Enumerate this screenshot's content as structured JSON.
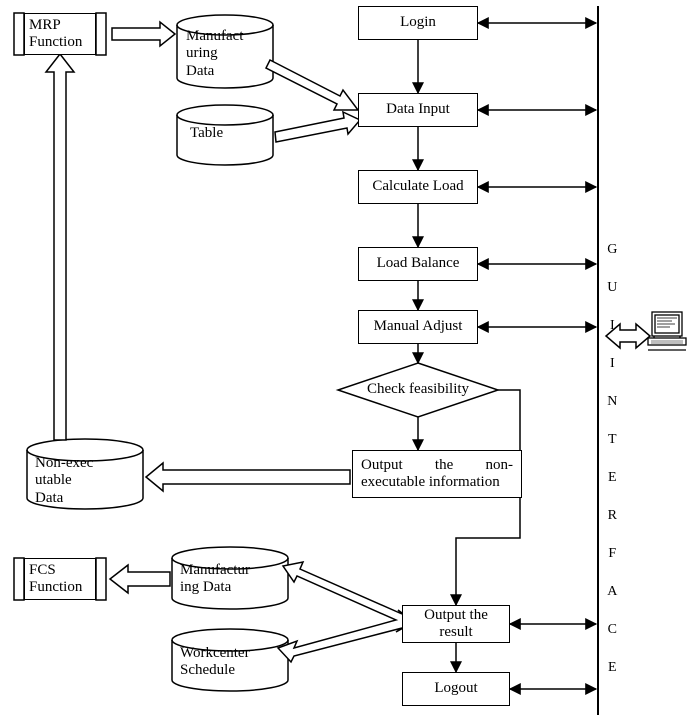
{
  "flow": {
    "login": "Login",
    "data_input": "Data Input",
    "calc_load": "Calculate Load",
    "load_balance": "Load Balance",
    "manual_adjust": "Manual Adjust",
    "check_feasibility": "Check feasibility",
    "output_nonexec": "Output the non-executable information",
    "output_result": "Output the result",
    "logout": "Logout"
  },
  "side": {
    "mrp": "MRP Function",
    "fcs": "FCS Function",
    "gui": "G U I   I N T E R F A C E"
  },
  "cyl": {
    "mfg_data_top": "Manufact\nuring\nData",
    "table": "Table",
    "nonexec": "Non-exec\nutable\nData",
    "mfg_data_bot": "Manufactur\ning Data",
    "workcenter": "Workcenter\nSchedule"
  },
  "chart_data": {
    "type": "diagram",
    "title": "",
    "nodes": [
      {
        "id": "mrp",
        "type": "process",
        "label": "MRP Function"
      },
      {
        "id": "mfg_data_top",
        "type": "datastore",
        "label": "Manufacturing Data"
      },
      {
        "id": "table",
        "type": "datastore",
        "label": "Table"
      },
      {
        "id": "login",
        "type": "process",
        "label": "Login"
      },
      {
        "id": "data_input",
        "type": "process",
        "label": "Data Input"
      },
      {
        "id": "calc_load",
        "type": "process",
        "label": "Calculate Load"
      },
      {
        "id": "load_balance",
        "type": "process",
        "label": "Load Balance"
      },
      {
        "id": "manual_adjust",
        "type": "process",
        "label": "Manual Adjust"
      },
      {
        "id": "check_feasibility",
        "type": "decision",
        "label": "Check feasibility"
      },
      {
        "id": "output_nonexec",
        "type": "process",
        "label": "Output the non-executable information"
      },
      {
        "id": "nonexec_data",
        "type": "datastore",
        "label": "Non-executable Data"
      },
      {
        "id": "fcs",
        "type": "process",
        "label": "FCS Function"
      },
      {
        "id": "mfg_data_bot",
        "type": "datastore",
        "label": "Manufacturing Data"
      },
      {
        "id": "workcenter",
        "type": "datastore",
        "label": "Workcenter Schedule"
      },
      {
        "id": "output_result",
        "type": "process",
        "label": "Output the result"
      },
      {
        "id": "logout",
        "type": "process",
        "label": "Logout"
      },
      {
        "id": "gui",
        "type": "interface",
        "label": "GUI INTERFACE"
      },
      {
        "id": "terminal",
        "type": "terminal",
        "label": ""
      }
    ],
    "edges": [
      {
        "from": "mrp",
        "to": "mfg_data_top",
        "style": "block-arrow"
      },
      {
        "from": "mfg_data_top",
        "to": "data_input",
        "style": "block-arrow"
      },
      {
        "from": "table",
        "to": "data_input",
        "style": "block-arrow"
      },
      {
        "from": "login",
        "to": "data_input",
        "style": "arrow"
      },
      {
        "from": "data_input",
        "to": "calc_load",
        "style": "arrow"
      },
      {
        "from": "calc_load",
        "to": "load_balance",
        "style": "arrow"
      },
      {
        "from": "load_balance",
        "to": "manual_adjust",
        "style": "arrow"
      },
      {
        "from": "manual_adjust",
        "to": "check_feasibility",
        "style": "arrow"
      },
      {
        "from": "check_feasibility",
        "to": "output_nonexec",
        "style": "arrow"
      },
      {
        "from": "output_nonexec",
        "to": "nonexec_data",
        "style": "block-arrow"
      },
      {
        "from": "nonexec_data",
        "to": "mrp",
        "style": "block-arrow"
      },
      {
        "from": "check_feasibility",
        "to": "output_result",
        "style": "arrow",
        "branch": "right"
      },
      {
        "from": "output_result",
        "to": "mfg_data_bot",
        "style": "block-arrow-bi"
      },
      {
        "from": "output_result",
        "to": "workcenter",
        "style": "block-arrow-bi"
      },
      {
        "from": "mfg_data_bot",
        "to": "fcs",
        "style": "block-arrow"
      },
      {
        "from": "output_result",
        "to": "logout",
        "style": "arrow"
      },
      {
        "from": "login",
        "to": "gui",
        "style": "bi-arrow"
      },
      {
        "from": "data_input",
        "to": "gui",
        "style": "bi-arrow"
      },
      {
        "from": "calc_load",
        "to": "gui",
        "style": "bi-arrow"
      },
      {
        "from": "load_balance",
        "to": "gui",
        "style": "bi-arrow"
      },
      {
        "from": "manual_adjust",
        "to": "gui",
        "style": "bi-arrow"
      },
      {
        "from": "output_result",
        "to": "gui",
        "style": "bi-arrow"
      },
      {
        "from": "logout",
        "to": "gui",
        "style": "bi-arrow"
      },
      {
        "from": "gui",
        "to": "terminal",
        "style": "block-arrow-bi"
      }
    ]
  }
}
